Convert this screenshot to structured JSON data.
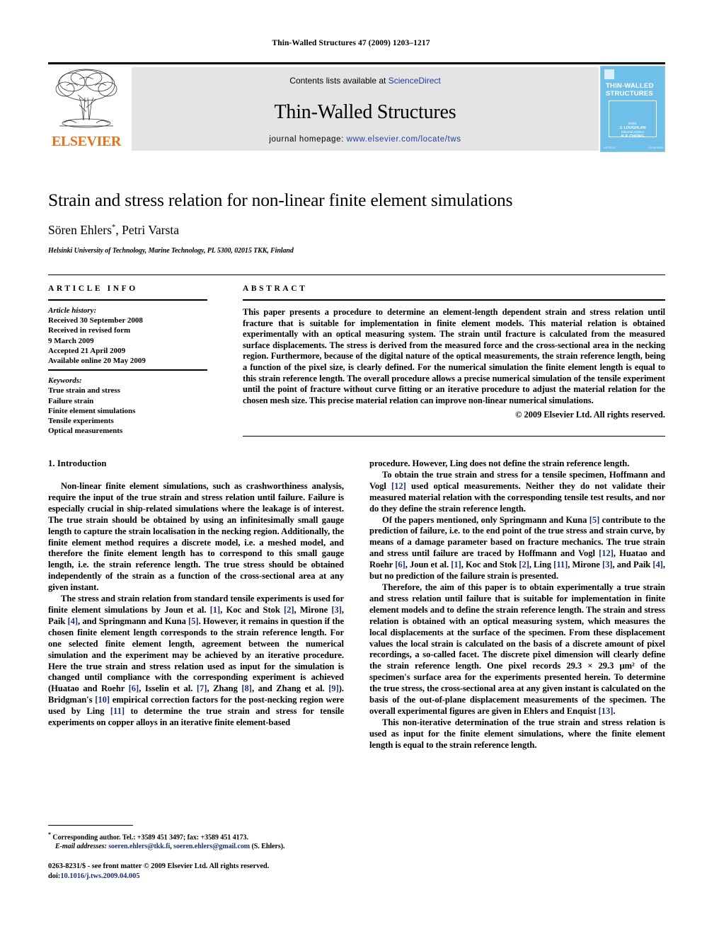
{
  "running_head": "Thin-Walled Structures 47 (2009) 1203–1217",
  "journal_header": {
    "contents_prefix": "Contents lists available at ",
    "contents_link": "ScienceDirect",
    "journal_name": "Thin-Walled Structures",
    "homepage_prefix": "journal homepage: ",
    "homepage_url": "www.elsevier.com/locate/tws",
    "publisher_logo_text": "ELSEVIER",
    "publisher_accent_color": "#e8711a",
    "link_color": "#1a3fa0"
  },
  "cover": {
    "title_line_1": "THIN-WALLED",
    "title_line_2": "STRUCTURES",
    "editor_label": "Editor",
    "editor_name": "J. LOUGHLAN",
    "associate_label": "Editorial Advisor",
    "associate_name": "K.P. CHONG",
    "footer_left": "ARTICLE",
    "footer_right": "ELSEVIER",
    "background_color": "#6ec0e8"
  },
  "article": {
    "title": "Strain and stress relation for non-linear finite element simulations",
    "authors": "Sören Ehlers",
    "authors_tail": ", Petri Varsta",
    "corresponding_marker": "*",
    "affiliation": "Helsinki University of Technology, Marine Technology, PL 5300, 02015 TKK, Finland"
  },
  "article_info": {
    "label": "ARTICLE INFO",
    "history_label": "Article history:",
    "history": [
      "Received 30 September 2008",
      "Received in revised form",
      "9 March 2009",
      "Accepted 21 April 2009",
      "Available online 20 May 2009"
    ],
    "keywords_label": "Keywords:",
    "keywords": [
      "True strain and stress",
      "Failure strain",
      "Finite element simulations",
      "Tensile experiments",
      "Optical measurements"
    ]
  },
  "abstract": {
    "label": "ABSTRACT",
    "text": "This paper presents a procedure to determine an element-length dependent strain and stress relation until fracture that is suitable for implementation in finite element models. This material relation is obtained experimentally with an optical measuring system. The strain until fracture is calculated from the measured surface displacements. The stress is derived from the measured force and the cross-sectional area in the necking region. Furthermore, because of the digital nature of the optical measurements, the strain reference length, being a function of the pixel size, is clearly defined. For the numerical simulation the finite element length is equal to this strain reference length. The overall procedure allows a precise numerical simulation of the tensile experiment until the point of fracture without curve fitting or an iterative procedure to adjust the material relation for the chosen mesh size. This precise material relation can improve non-linear numerical simulations.",
    "copyright": "© 2009 Elsevier Ltd. All rights reserved."
  },
  "body": {
    "section_number_title": "1. Introduction",
    "left_paragraphs": [
      "Non-linear finite element simulations, such as crashworthiness analysis, require the input of the true strain and stress relation until failure. Failure is especially crucial in ship-related simulations where the leakage is of interest. The true strain should be obtained by using an infinitesimally small gauge length to capture the strain localisation in the necking region. Additionally, the finite element method requires a discrete model, i.e. a meshed model, and therefore the finite element length has to correspond to this small gauge length, i.e. the strain reference length. The true stress should be obtained independently of the strain as a function of the cross-sectional area at any given instant.",
      "The stress and strain relation from standard tensile experiments is used for finite element simulations by Joun et al. [1], Koc and Stok [2], Mirone [3], Paik [4], and Springmann and Kuna [5]. However, it remains in question if the chosen finite element length corresponds to the strain reference length. For one selected finite element length, agreement between the numerical simulation and the experiment may be achieved by an iterative procedure. Here the true strain and stress relation used as input for the simulation is changed until compliance with the corresponding experiment is achieved (Huatao and Roehr [6], Isselin et al. [7], Zhang [8], and Zhang et al. [9]). Bridgman's [10] empirical correction factors for the post-necking region were used by Ling [11] to determine the true strain and stress for tensile experiments on copper alloys in an iterative finite element-based"
    ],
    "right_paragraphs": [
      "procedure. However, Ling does not define the strain reference length.",
      "To obtain the true strain and stress for a tensile specimen, Hoffmann and Vogl [12] used optical measurements. Neither they do not validate their measured material relation with the corresponding tensile test results, and nor do they define the strain reference length.",
      "Of the papers mentioned, only Springmann and Kuna [5] contribute to the prediction of failure, i.e. to the end point of the true stress and strain curve, by means of a damage parameter based on fracture mechanics. The true strain and stress until failure are traced by Hoffmann and Vogl [12], Huatao and Roehr [6], Joun et al. [1], Koc and Stok [2], Ling [11], Mirone [3], and Paik [4], but no prediction of the failure strain is presented.",
      "Therefore, the aim of this paper is to obtain experimentally a true strain and stress relation until failure that is suitable for implementation in finite element models and to define the strain reference length. The strain and stress relation is obtained with an optical measuring system, which measures the local displacements at the surface of the specimen. From these displacement values the local strain is calculated on the basis of a discrete amount of pixel recordings, a so-called facet. The discrete pixel dimension will clearly define the strain reference length. One pixel records 29.3 × 29.3 μm² of the specimen's surface area for the experiments presented herein. To determine the true stress, the cross-sectional area at any given instant is calculated on the basis of the out-of-plane displacement measurements of the specimen. The overall experimental figures are given in Ehlers and Enquist [13].",
      "This non-iterative determination of the true strain and stress relation is used as input for the finite element simulations, where the finite element length is equal to the strain reference length."
    ],
    "reference_color": "#1c2f78"
  },
  "footnote": {
    "marker": "*",
    "corresponding": "Corresponding author. Tel.: +3589 451 3497; fax: +3589 451 4173.",
    "email_label": "E-mail addresses:",
    "email_1": "soeren.ehlers@tkk.fi",
    "email_2": "soeren.ehlers@gmail.com",
    "email_suffix": "(S. Ehlers)."
  },
  "bottom_matter": {
    "front_matter": "0263-8231/$ - see front matter © 2009 Elsevier Ltd. All rights reserved.",
    "doi_label": "doi:",
    "doi": "10.1016/j.tws.2009.04.005"
  }
}
